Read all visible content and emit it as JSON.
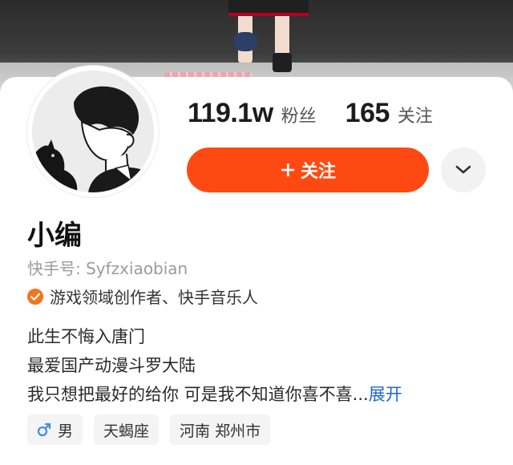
{
  "profile": {
    "followers_count": "119.1w",
    "followers_label": "粉丝",
    "following_count": "165",
    "following_label": "关注",
    "follow_button_label": "关注",
    "name": "小编",
    "kuaishou_id": "快手号: Syfzxiaobian",
    "verification": "游戏领域创作者、快手音乐人",
    "bio_lines": [
      "此生不悔入唐门",
      "最爱国产动漫斗罗大陆",
      "我只想把最好的给你 可是我不知道你喜不喜..."
    ],
    "bio_expand": "展开",
    "tags": {
      "gender": "男",
      "zodiac": "天蝎座",
      "location": "河南 郑州市"
    }
  },
  "colors": {
    "accent": "#fe4a12",
    "verify_badge": "#f4731f",
    "link": "#1f67c8",
    "male_icon": "#3a8ee6"
  },
  "icons": {
    "follow": "plus-icon",
    "more": "chevron-down-icon",
    "verify": "verified-badge-icon",
    "gender": "male-icon"
  }
}
